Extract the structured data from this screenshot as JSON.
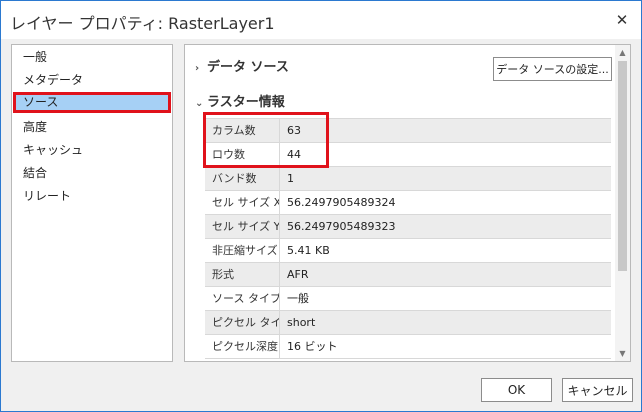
{
  "window": {
    "title": "レイヤー プロパティ: RasterLayer1",
    "close_glyph": "✕"
  },
  "sidebar": {
    "items": [
      {
        "label": "一般"
      },
      {
        "label": "メタデータ"
      },
      {
        "label": "ソース",
        "selected": true
      },
      {
        "label": "高度"
      },
      {
        "label": "キャッシュ"
      },
      {
        "label": "結合"
      },
      {
        "label": "リレート"
      }
    ]
  },
  "main": {
    "data_source": {
      "label": "データ ソース",
      "expanded": false,
      "settings_button": "データ ソースの設定..."
    },
    "raster_info": {
      "label": "ラスター情報",
      "expanded": true,
      "rows": [
        {
          "label": "カラム数",
          "value": "63"
        },
        {
          "label": "ロウ数",
          "value": "44"
        },
        {
          "label": "バンド数",
          "value": "1"
        },
        {
          "label": "セル サイズ X",
          "value": "56.2497905489324"
        },
        {
          "label": "セル サイズ Y",
          "value": "56.2497905489323"
        },
        {
          "label": "非圧縮サイズ",
          "value": "5.41 KB"
        },
        {
          "label": "形式",
          "value": "AFR"
        },
        {
          "label": "ソース タイプ",
          "value": "一般"
        },
        {
          "label": "ピクセル タイプ",
          "value": "short"
        },
        {
          "label": "ピクセル深度",
          "value": "16 ビット"
        }
      ]
    }
  },
  "footer": {
    "ok_label": "OK",
    "cancel_label": "キャンセル"
  },
  "icons": {
    "chevron_right": "›",
    "chevron_down": "⌄",
    "scroll_up": "▲",
    "scroll_down": "▼"
  },
  "colors": {
    "accent_border": "#2b79d0",
    "selection": "#a6d0f5",
    "highlight": "#e0121b"
  }
}
